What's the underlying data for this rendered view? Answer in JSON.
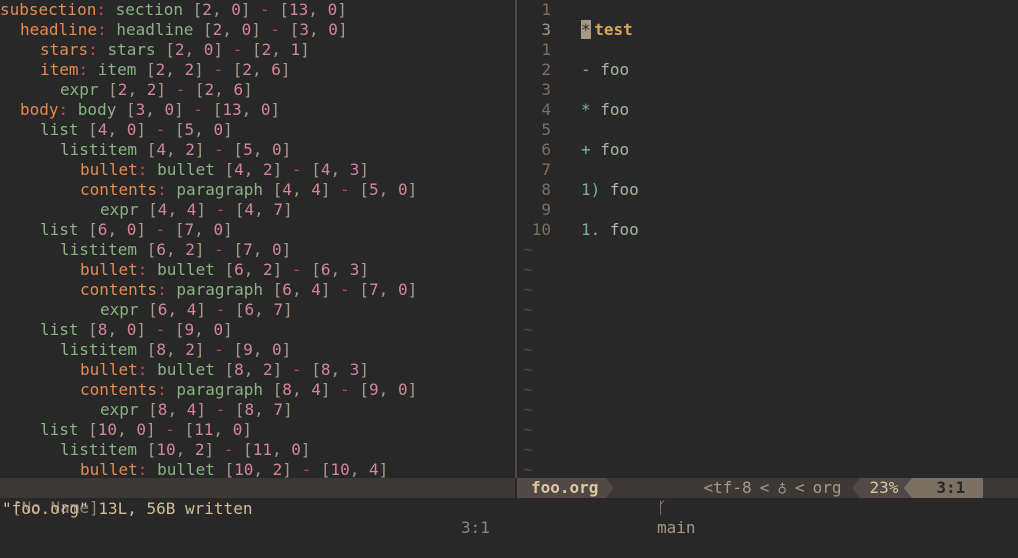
{
  "tree_lines": [
    {
      "indent": 0,
      "field": "subsection",
      "node": "section",
      "start": [
        2,
        0
      ],
      "end": [
        13,
        0
      ]
    },
    {
      "indent": 1,
      "field": "headline",
      "node": "headline",
      "start": [
        2,
        0
      ],
      "end": [
        3,
        0
      ]
    },
    {
      "indent": 2,
      "field": "stars",
      "node": "stars",
      "start": [
        2,
        0
      ],
      "end": [
        2,
        1
      ]
    },
    {
      "indent": 2,
      "field": "item",
      "node": "item",
      "start": [
        2,
        2
      ],
      "end": [
        2,
        6
      ]
    },
    {
      "indent": 3,
      "field": "",
      "node": "expr",
      "start": [
        2,
        2
      ],
      "end": [
        2,
        6
      ]
    },
    {
      "indent": 1,
      "field": "body",
      "node": "body",
      "start": [
        3,
        0
      ],
      "end": [
        13,
        0
      ]
    },
    {
      "indent": 2,
      "field": "",
      "node": "list",
      "start": [
        4,
        0
      ],
      "end": [
        5,
        0
      ]
    },
    {
      "indent": 3,
      "field": "",
      "node": "listitem",
      "start": [
        4,
        2
      ],
      "end": [
        5,
        0
      ]
    },
    {
      "indent": 4,
      "field": "bullet",
      "node": "bullet",
      "start": [
        4,
        2
      ],
      "end": [
        4,
        3
      ]
    },
    {
      "indent": 4,
      "field": "contents",
      "node": "paragraph",
      "start": [
        4,
        4
      ],
      "end": [
        5,
        0
      ]
    },
    {
      "indent": 5,
      "field": "",
      "node": "expr",
      "start": [
        4,
        4
      ],
      "end": [
        4,
        7
      ]
    },
    {
      "indent": 2,
      "field": "",
      "node": "list",
      "start": [
        6,
        0
      ],
      "end": [
        7,
        0
      ]
    },
    {
      "indent": 3,
      "field": "",
      "node": "listitem",
      "start": [
        6,
        2
      ],
      "end": [
        7,
        0
      ]
    },
    {
      "indent": 4,
      "field": "bullet",
      "node": "bullet",
      "start": [
        6,
        2
      ],
      "end": [
        6,
        3
      ]
    },
    {
      "indent": 4,
      "field": "contents",
      "node": "paragraph",
      "start": [
        6,
        4
      ],
      "end": [
        7,
        0
      ]
    },
    {
      "indent": 5,
      "field": "",
      "node": "expr",
      "start": [
        6,
        4
      ],
      "end": [
        6,
        7
      ]
    },
    {
      "indent": 2,
      "field": "",
      "node": "list",
      "start": [
        8,
        0
      ],
      "end": [
        9,
        0
      ]
    },
    {
      "indent": 3,
      "field": "",
      "node": "listitem",
      "start": [
        8,
        2
      ],
      "end": [
        9,
        0
      ]
    },
    {
      "indent": 4,
      "field": "bullet",
      "node": "bullet",
      "start": [
        8,
        2
      ],
      "end": [
        8,
        3
      ]
    },
    {
      "indent": 4,
      "field": "contents",
      "node": "paragraph",
      "start": [
        8,
        4
      ],
      "end": [
        9,
        0
      ]
    },
    {
      "indent": 5,
      "field": "",
      "node": "expr",
      "start": [
        8,
        4
      ],
      "end": [
        8,
        7
      ]
    },
    {
      "indent": 2,
      "field": "",
      "node": "list",
      "start": [
        10,
        0
      ],
      "end": [
        11,
        0
      ]
    },
    {
      "indent": 3,
      "field": "",
      "node": "listitem",
      "start": [
        10,
        2
      ],
      "end": [
        11,
        0
      ]
    },
    {
      "indent": 4,
      "field": "bullet",
      "node": "bullet",
      "start": [
        10,
        2
      ],
      "end": [
        10,
        4
      ]
    }
  ],
  "editor_lines": [
    {
      "num": "1",
      "current": false,
      "kind": "empty",
      "bullet": "",
      "text": ""
    },
    {
      "num": "3",
      "current": true,
      "kind": "headline",
      "bullet": "*",
      "text": "test"
    },
    {
      "num": "1",
      "current": false,
      "kind": "empty",
      "bullet": "",
      "text": ""
    },
    {
      "num": "2",
      "current": false,
      "kind": "item",
      "bullet": "-",
      "text": "foo"
    },
    {
      "num": "3",
      "current": false,
      "kind": "empty",
      "bullet": "",
      "text": ""
    },
    {
      "num": "4",
      "current": false,
      "kind": "item",
      "bullet": "*",
      "text": "foo"
    },
    {
      "num": "5",
      "current": false,
      "kind": "empty",
      "bullet": "",
      "text": ""
    },
    {
      "num": "6",
      "current": false,
      "kind": "item",
      "bullet": "+",
      "text": "foo"
    },
    {
      "num": "7",
      "current": false,
      "kind": "empty",
      "bullet": "",
      "text": ""
    },
    {
      "num": "8",
      "current": false,
      "kind": "item",
      "bullet": "1)",
      "text": "foo"
    },
    {
      "num": "9",
      "current": false,
      "kind": "empty",
      "bullet": "",
      "text": ""
    },
    {
      "num": "10",
      "current": false,
      "kind": "item",
      "bullet": "1.",
      "text": "foo"
    }
  ],
  "tilde_count": 12,
  "tilde_char": "~",
  "status_left": {
    "name": "[No Name]",
    "position": "3:1"
  },
  "status_right": {
    "filename": "foo.org",
    "branch_icon": "git-branch-icon",
    "branch_glyph": "ᚴ",
    "branch": "main",
    "encoding": "<tf-8",
    "os_icon": "linux-icon",
    "os_glyph": "♁",
    "filetype": "org",
    "percent": "23%",
    "cursor": "3:1"
  },
  "command_line": "\"foo.org\" 13L, 56B written",
  "colors": {
    "background": "#282828",
    "field": "#e78a4e",
    "node": "#89b482",
    "punctuation": "#c14a4a",
    "number": "#d3869b",
    "headline": "#d8a657",
    "bullet": "#7daea3"
  }
}
